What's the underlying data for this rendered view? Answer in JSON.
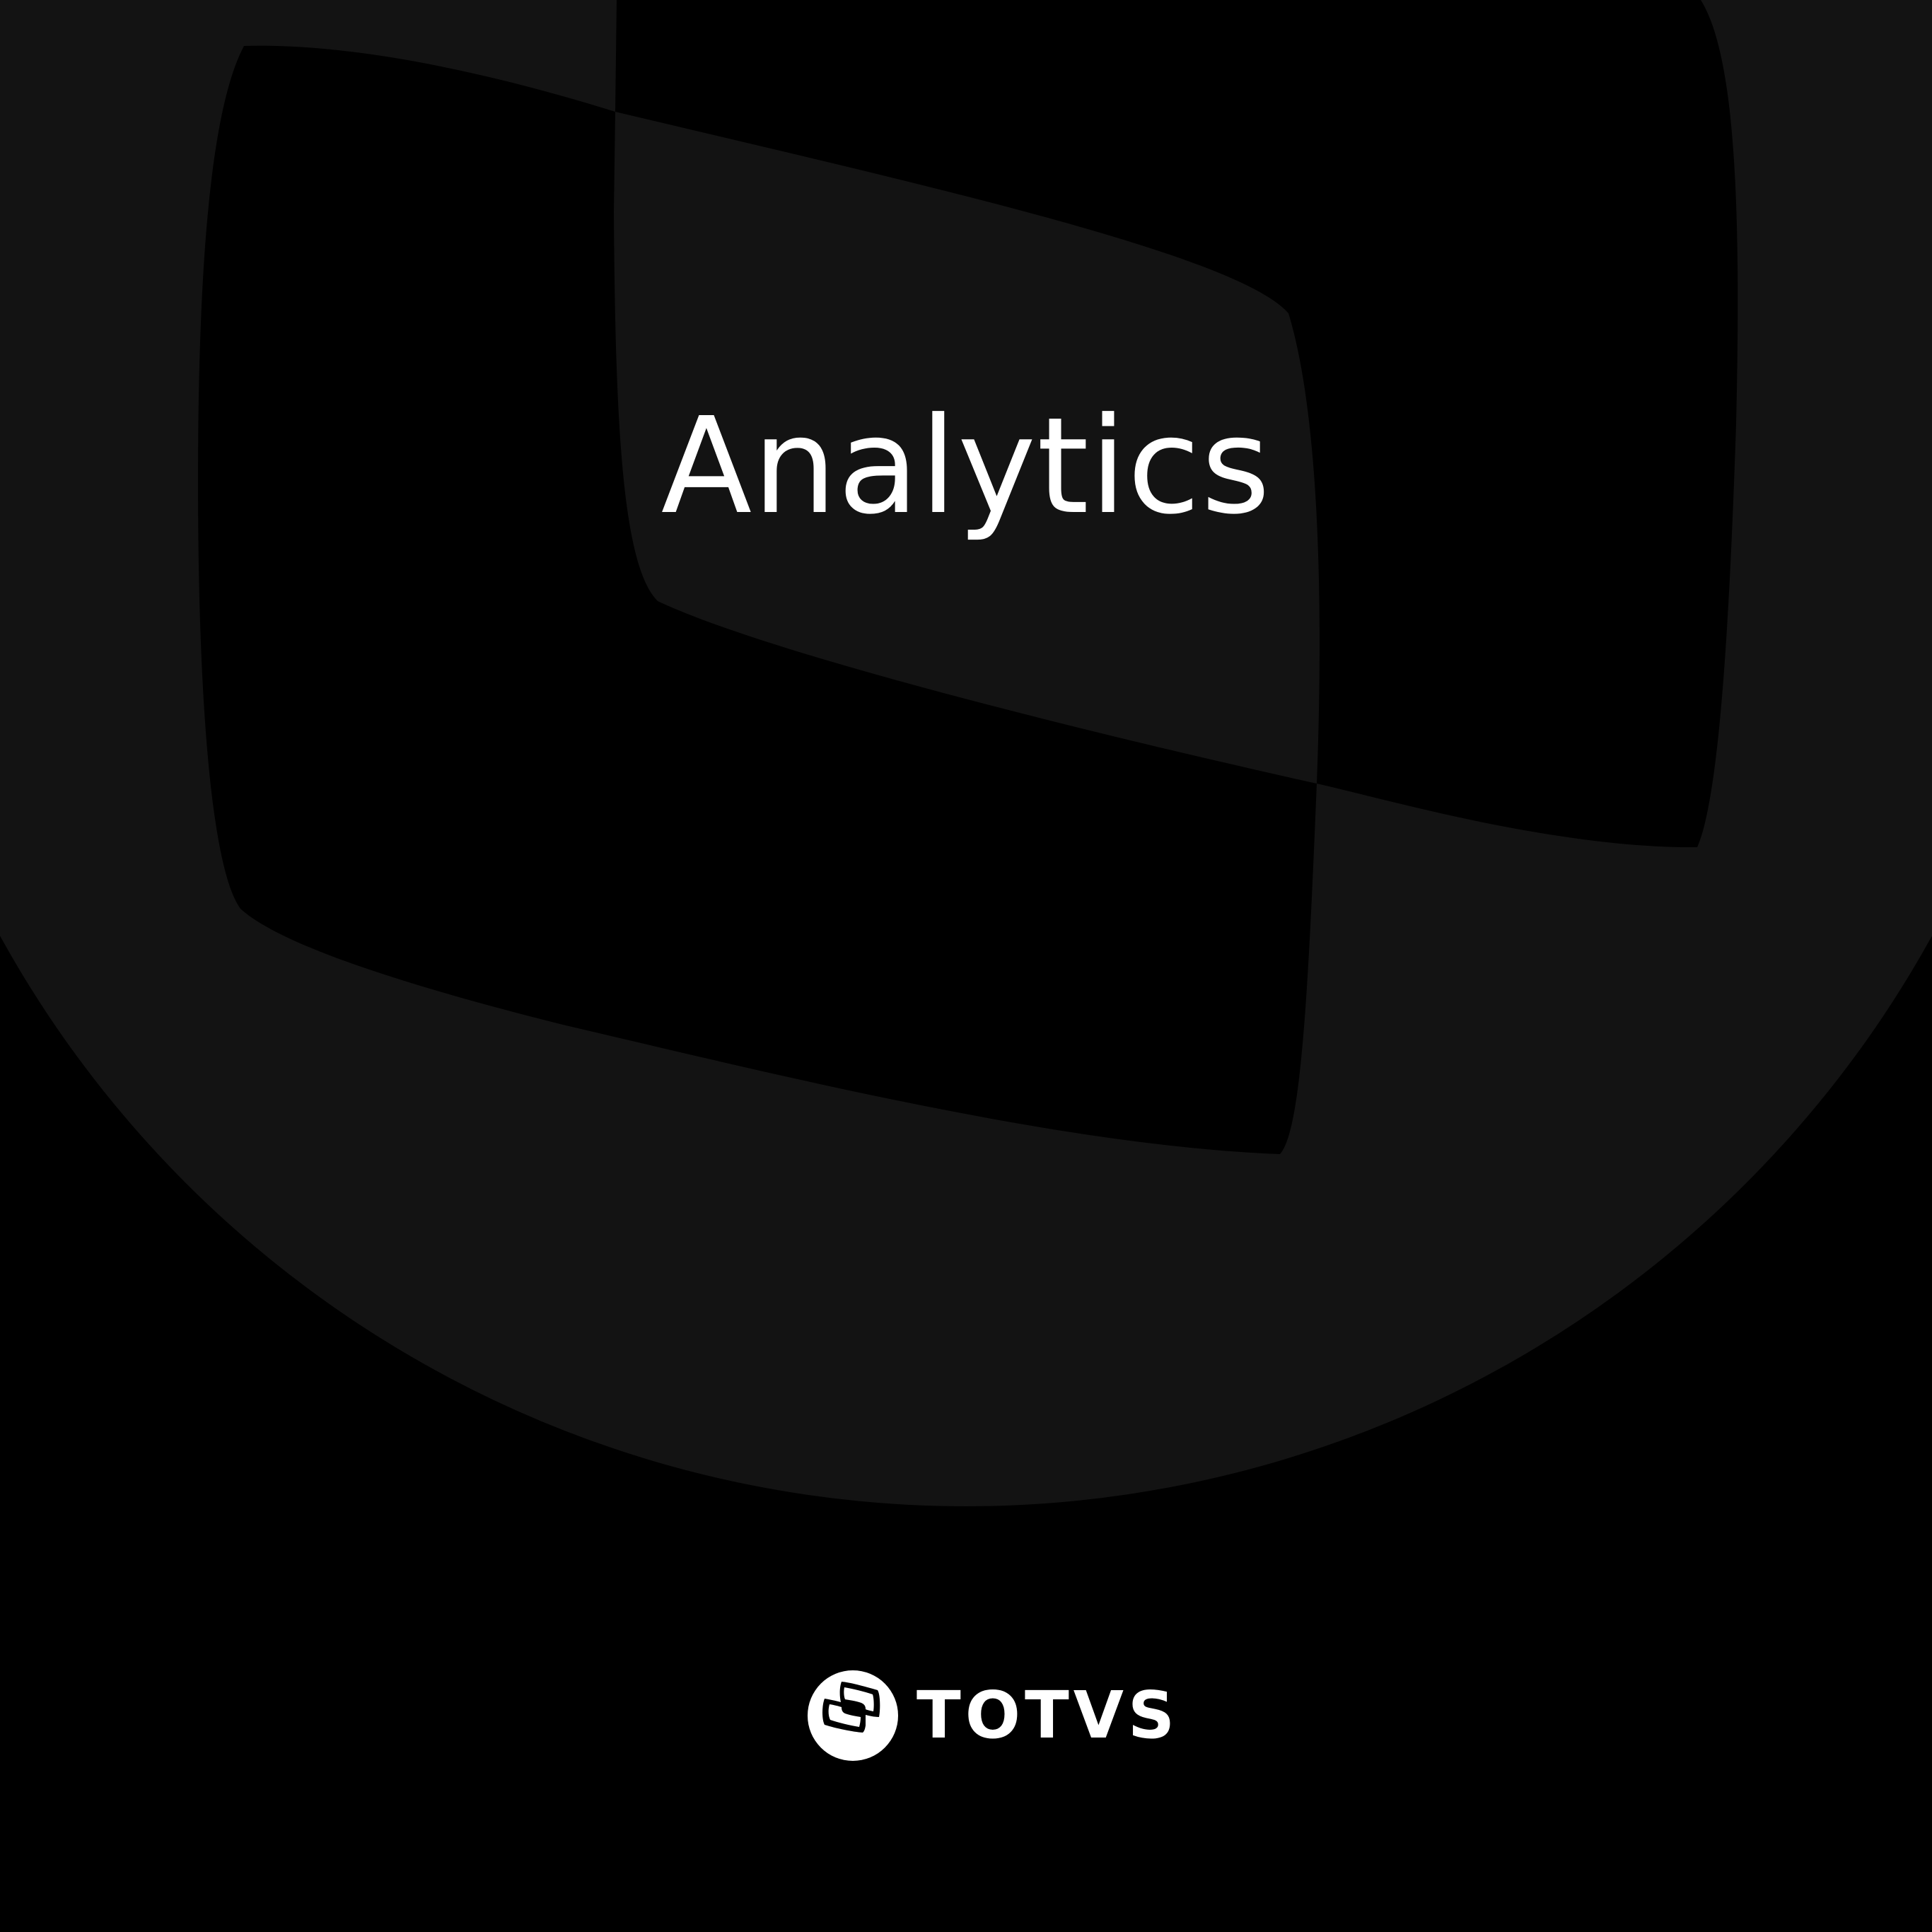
{
  "page": {
    "title": "Analytics"
  },
  "brand": {
    "name": "TOTVS",
    "logo_icon": "totvs-logo-icon"
  },
  "colors": {
    "background": "#000000",
    "emblem": "#131313",
    "text": "#ffffff"
  }
}
